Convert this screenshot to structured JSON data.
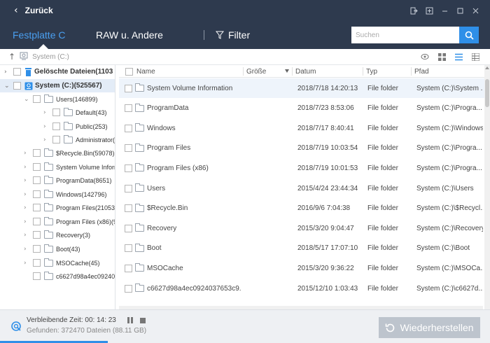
{
  "titlebar": {
    "back_label": "Zurück"
  },
  "tabs": {
    "harddisk": "Festplatte C",
    "raw": "RAW u. Andere",
    "filter": "Filter"
  },
  "search": {
    "placeholder": "Suchen"
  },
  "path": {
    "text": "System (C:)"
  },
  "tree": {
    "deleted": "Gelöschte Dateien(1103",
    "system": "System (C:)(525567)",
    "users": "Users(146899)",
    "default": "Default(43)",
    "public": "Public(253)",
    "administrator": "Administrator(",
    "recycle": "$Recycle.Bin(59078)",
    "svi": "System Volume Inform",
    "programdata": "ProgramData(8651)",
    "windows": "Windows(142796)",
    "programfiles": "Program Files(21053)",
    "programfilesx86": "Program Files (x86)(913",
    "recovery": "Recovery(3)",
    "boot": "Boot(43)",
    "msocache": "MSOCache(45)",
    "hash": "c6627d98a4ec09240376"
  },
  "columns": {
    "name": "Name",
    "size": "Größe",
    "date": "Datum",
    "type": "Typ",
    "path": "Pfad"
  },
  "rows": [
    {
      "name": "System Volume Information",
      "date": "2018/7/18 14:20:13",
      "type": "File folder",
      "path": "System (C:)\\System ..."
    },
    {
      "name": "ProgramData",
      "date": "2018/7/23 8:53:06",
      "type": "File folder",
      "path": "System (C:)\\Progra..."
    },
    {
      "name": "Windows",
      "date": "2018/7/17 8:40:41",
      "type": "File folder",
      "path": "System (C:)\\Windows"
    },
    {
      "name": "Program Files",
      "date": "2018/7/19 10:03:54",
      "type": "File folder",
      "path": "System (C:)\\Progra..."
    },
    {
      "name": "Program Files (x86)",
      "date": "2018/7/19 10:01:53",
      "type": "File folder",
      "path": "System (C:)\\Progra..."
    },
    {
      "name": "Users",
      "date": "2015/4/24 23:44:34",
      "type": "File folder",
      "path": "System (C:)\\Users"
    },
    {
      "name": "$Recycle.Bin",
      "date": "2016/9/6 7:04:38",
      "type": "File folder",
      "path": "System (C:)\\$Recycl..."
    },
    {
      "name": "Recovery",
      "date": "2015/3/20 9:04:47",
      "type": "File folder",
      "path": "System (C:)\\Recovery"
    },
    {
      "name": "Boot",
      "date": "2018/5/17 17:07:10",
      "type": "File folder",
      "path": "System (C:)\\Boot"
    },
    {
      "name": "MSOCache",
      "date": "2015/3/20 9:36:22",
      "type": "File folder",
      "path": "System (C:)\\MSOCa..."
    },
    {
      "name": "c6627d98a4ec0924037653c9...",
      "date": "2015/12/10 1:03:43",
      "type": "File folder",
      "path": "System (C:)\\c6627d..."
    }
  ],
  "status": {
    "remaining": "Verbleibende Zeit: 00: 14: 23",
    "found": "Gefunden: 372470 Dateien (88.11 GB)"
  },
  "recover_label": "Wiederherstellen",
  "progress": {
    "fraction": 0.22
  },
  "colors": {
    "titlebar": "#2e3a4e",
    "accent": "#2f8fe8",
    "active_tab": "#4a9ff0",
    "selected_row": "#eef4fb",
    "recover_disabled": "#bdc4cd"
  }
}
